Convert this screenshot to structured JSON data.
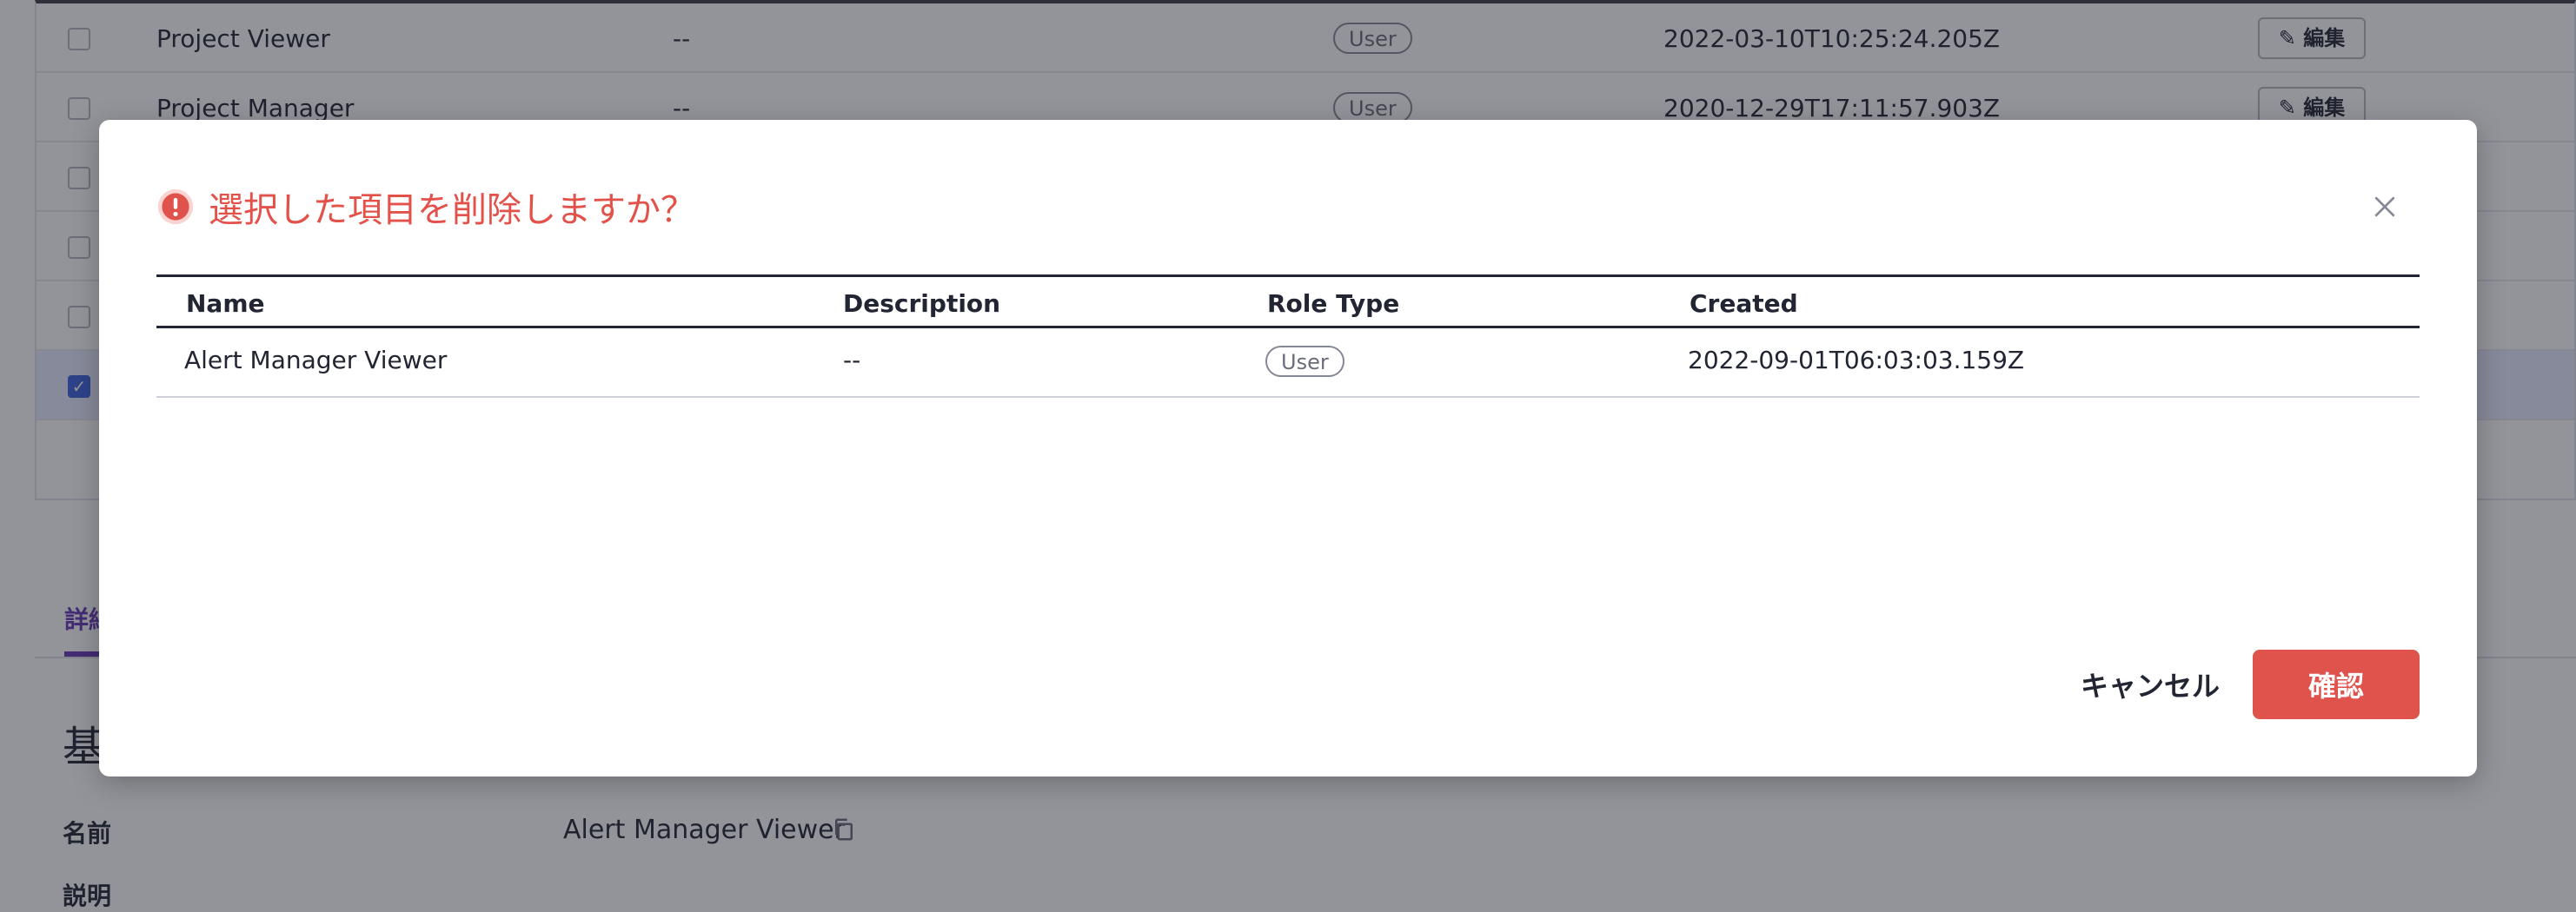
{
  "background": {
    "rows": [
      {
        "name": "Project Viewer",
        "description": "--",
        "role_type": "User",
        "created": "2022-03-10T10:25:24.205Z",
        "edit_label": "編集"
      },
      {
        "name": "Project Manager",
        "description": "--",
        "role_type": "User",
        "created": "2020-12-29T17:11:57.903Z",
        "edit_label": "編集"
      }
    ],
    "tab_label": "詳細",
    "section_title": "基本情報",
    "detail_labels": [
      "名前",
      "説明"
    ],
    "detail_name_value": "Alert Manager Viewer"
  },
  "modal": {
    "title": "選択した項目を削除しますか？",
    "columns": [
      "Name",
      "Description",
      "Role Type",
      "Created"
    ],
    "rows": [
      {
        "name": "Alert Manager Viewer",
        "description": "--",
        "role_type": "User",
        "created": "2022-09-01T06:03:03.159Z"
      }
    ],
    "cancel_label": "キャンセル",
    "confirm_label": "確認"
  },
  "colors": {
    "danger": "#e0524c",
    "accent": "#6638b6",
    "selected_row": "#e9ecff"
  },
  "icons": {
    "alert": "exclamation-circle-icon",
    "close": "close-icon",
    "edit": "pencil-icon",
    "copy": "copy-icon"
  }
}
